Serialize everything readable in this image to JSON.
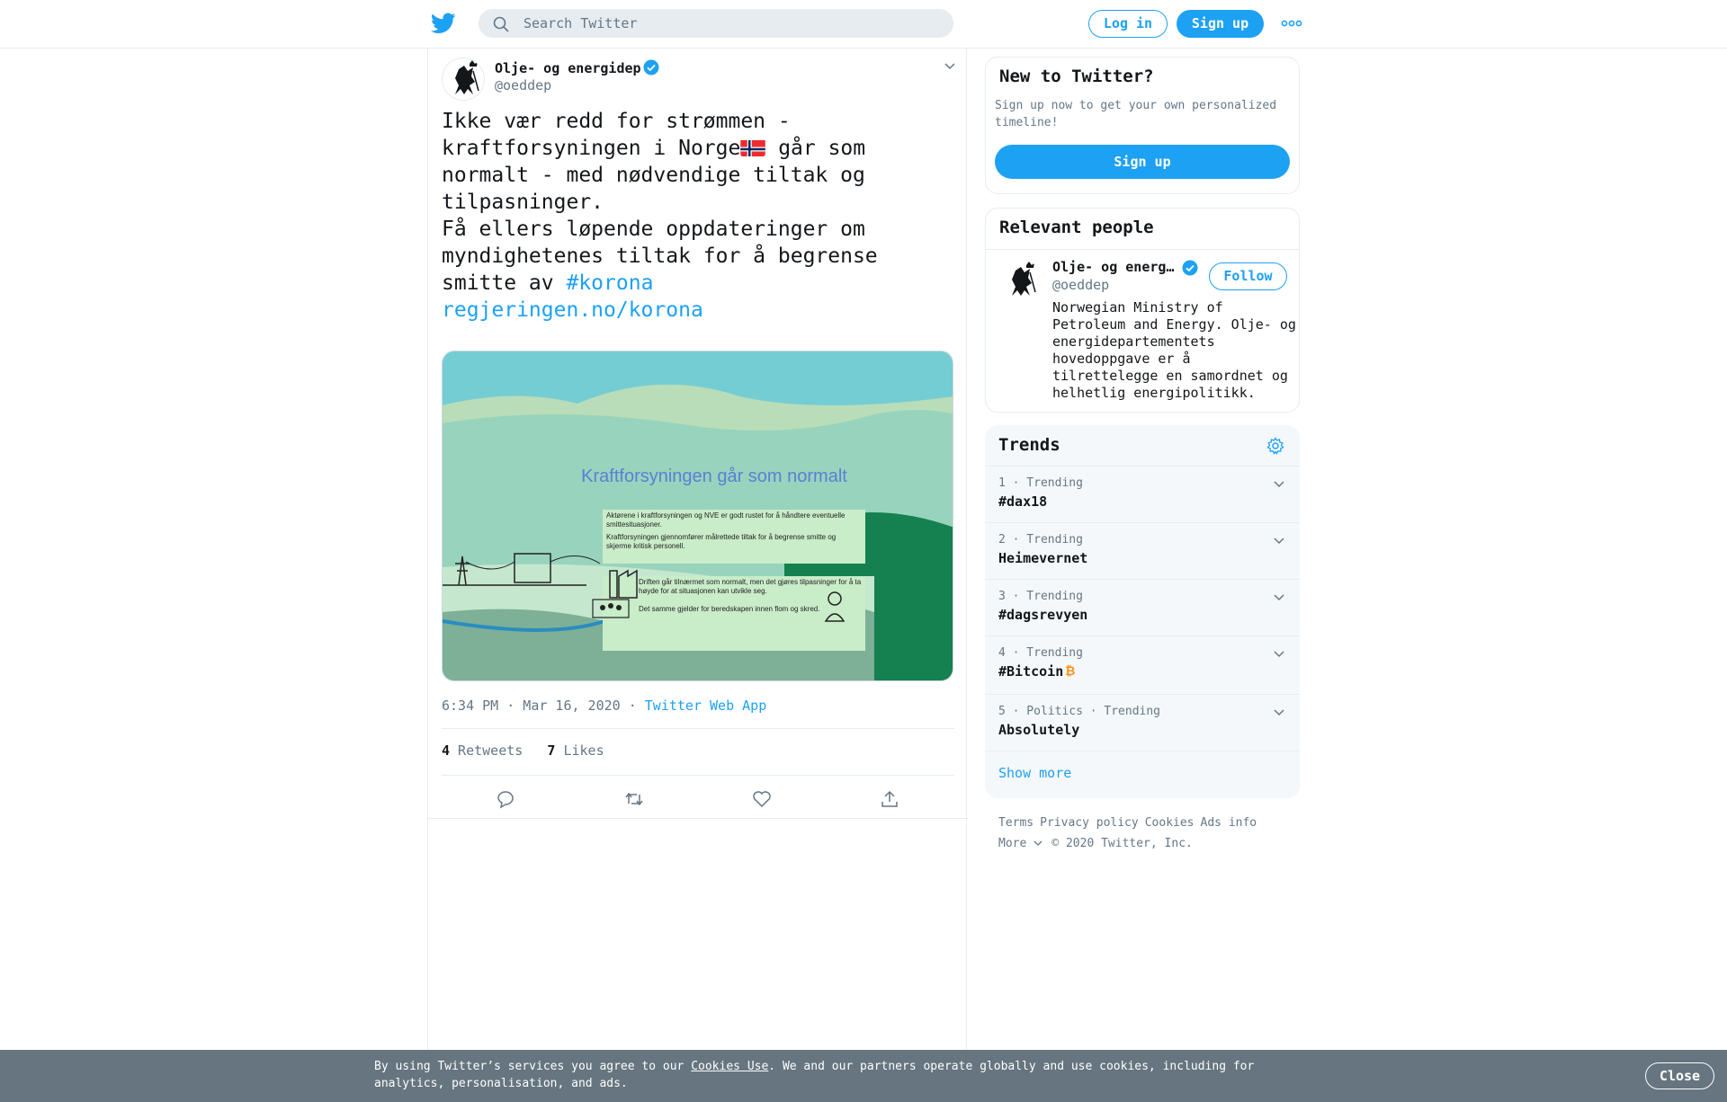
{
  "header": {
    "search_placeholder": "Search Twitter",
    "login_label": "Log in",
    "signup_label": "Sign up",
    "more_icon": "more-dots-icon"
  },
  "tweet": {
    "author_name": "Olje- og energidep",
    "author_handle": "@oeddep",
    "text_line1": "Ikke vær redd for strømmen -\nkraftforsyningen i Norge",
    "text_line2": " går som\nnormalt - med nødvendige tiltak og\ntilpasninger.\nFå ellers løpende oppdateringer om\nmyndighetenes tiltak for å begrense\nsmitte av ",
    "hashtag": "#korona",
    "link": "regjeringen.no/korona",
    "image": {
      "title": "Kraftforsyningen går som normalt",
      "bullet1": "Aktørene i kraftforsyningen og NVE er godt rustet for å håndtere eventuelle smittesituasjoner.",
      "bullet2": "Kraftforsyningen gjennomfører målrettede tiltak for å begrense smitte og skjerme kritisk personell.",
      "bullet3": "Driften går tilnærmet som normalt, men det gjøres tilpasninger for å ta høyde for at situasjonen kan utvikle seg.",
      "bullet4": "Det samme gjelder for beredskapen innen flom og skred."
    },
    "time": "6:34 PM · Mar 16, 2020 · ",
    "source": "Twitter Web App",
    "retweets": "4",
    "retweets_label": " Retweets",
    "likes": "7",
    "likes_label": " Likes"
  },
  "sidebar": {
    "new_title": "New to Twitter?",
    "new_text": "Sign up now to get your own personalized timeline!",
    "new_button": "Sign up",
    "relevant_title": "Relevant people",
    "person_name": "Olje- og energidep",
    "person_handle": "@oeddep",
    "follow_label": "Follow",
    "person_bio": "Norwegian Ministry of Petroleum and Energy. Olje- og energidepartementets hovedoppgave er å tilrettelegge en samordnet og helhetlig energipolitikk.",
    "trends_title": "Trends",
    "trends": [
      {
        "context": "1 · Trending",
        "name": "#dax18"
      },
      {
        "context": "2 · Trending",
        "name": "Heimevernet"
      },
      {
        "context": "3 · Trending",
        "name": "#dagsrevyen"
      },
      {
        "context": "4 · Trending",
        "name": "#Bitcoin"
      },
      {
        "context": "5 · Politics · Trending",
        "name": "Absolutely"
      }
    ],
    "show_more": "Show more",
    "footer_links": [
      "Terms",
      "Privacy policy",
      "Cookies",
      "Ads info"
    ],
    "footer_more": "More",
    "copyright": "© 2020 Twitter, Inc."
  },
  "cookie": {
    "text_before": "By using Twitter’s services you agree to our ",
    "link": "Cookies Use",
    "text_after": ". We and our partners operate globally and use cookies, including for analytics, personalisation, and ads.",
    "close_label": "Close"
  },
  "colors": {
    "accent": "#1da1f2",
    "muted": "#657786",
    "border": "#e6ecf0",
    "bitcoin": "#f7931a"
  }
}
